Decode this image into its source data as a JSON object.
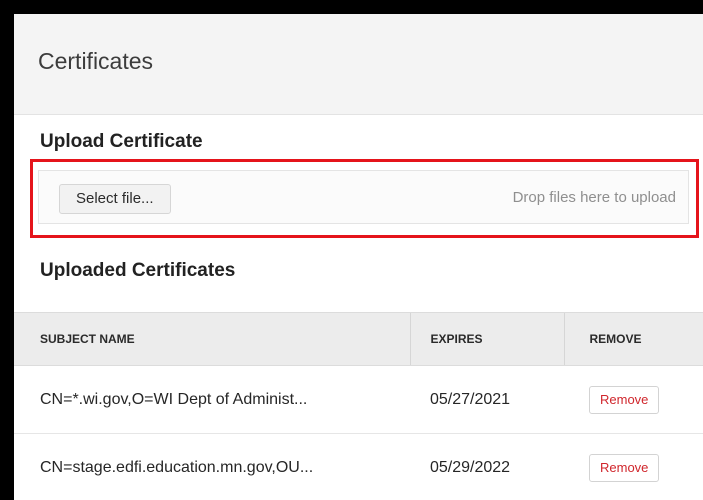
{
  "panel": {
    "title": "Certificates"
  },
  "upload": {
    "heading": "Upload Certificate",
    "select_label": "Select file...",
    "drop_hint": "Drop files here to upload"
  },
  "uploaded": {
    "heading": "Uploaded Certificates",
    "columns": {
      "subject": "SUBJECT NAME",
      "expires": "EXPIRES",
      "remove": "REMOVE"
    },
    "rows": [
      {
        "subject": "CN=*.wi.gov,O=WI Dept of Administ...",
        "expires": "05/27/2021",
        "remove_label": "Remove"
      },
      {
        "subject": "CN=stage.edfi.education.mn.gov,OU...",
        "expires": "05/29/2022",
        "remove_label": "Remove"
      }
    ]
  },
  "colors": {
    "highlight": "#e5141b",
    "remove_text": "#d0262c",
    "header_bg": "#f4f4f4",
    "table_header_bg": "#ececec"
  }
}
